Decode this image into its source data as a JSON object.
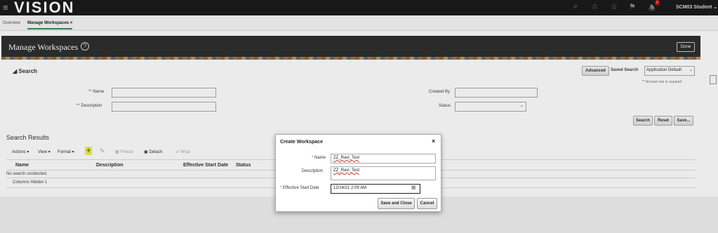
{
  "app": {
    "logo": "VISION",
    "user": "SCM03 Student",
    "notification_count": "9"
  },
  "icons": [
    "menu-icon",
    "search-icon",
    "home-icon",
    "star-icon",
    "flag-icon",
    "bell-icon",
    "chevron-down-icon"
  ],
  "tabs": [
    {
      "label": "Overview"
    },
    {
      "label": "Manage Workspaces",
      "close": "×"
    }
  ],
  "page": {
    "title": "Manage Workspaces",
    "help": "?",
    "done_label": "Done"
  },
  "search": {
    "heading": "Search",
    "advanced_label": "Advanced",
    "saved_search_label": "Saved Search",
    "saved_search_value": "Application Default",
    "hint": "** At least one is required",
    "name_label": "Name",
    "description_label": "Description",
    "created_by_label": "Created By",
    "status_label": "Status",
    "req_mark": "**",
    "search_button": "Search",
    "reset_button": "Reset",
    "save_button": "Save..."
  },
  "results": {
    "title": "Search Results",
    "toolbar": {
      "actions": "Actions",
      "view": "View",
      "format": "Format",
      "freeze": "Freeze",
      "detach": "Detach",
      "wrap": "Wrap"
    },
    "columns": [
      "Name",
      "Description",
      "Effective Start Date",
      "Status"
    ],
    "empty_text": "No search conducted.",
    "columns_hidden": "Columns Hidden  1"
  },
  "dialog": {
    "title": "Create Workspace",
    "close": "×",
    "name_label": "Name",
    "name_value": "ZZ_Ravi_Test",
    "description_label": "Description",
    "description_value": "ZZ_Ravi_Test",
    "start_label": "Effective Start Date",
    "start_value": "12/14/21 2:09 AM",
    "req_mark": "*",
    "save_close": "Save and Close",
    "cancel": "Cancel"
  }
}
